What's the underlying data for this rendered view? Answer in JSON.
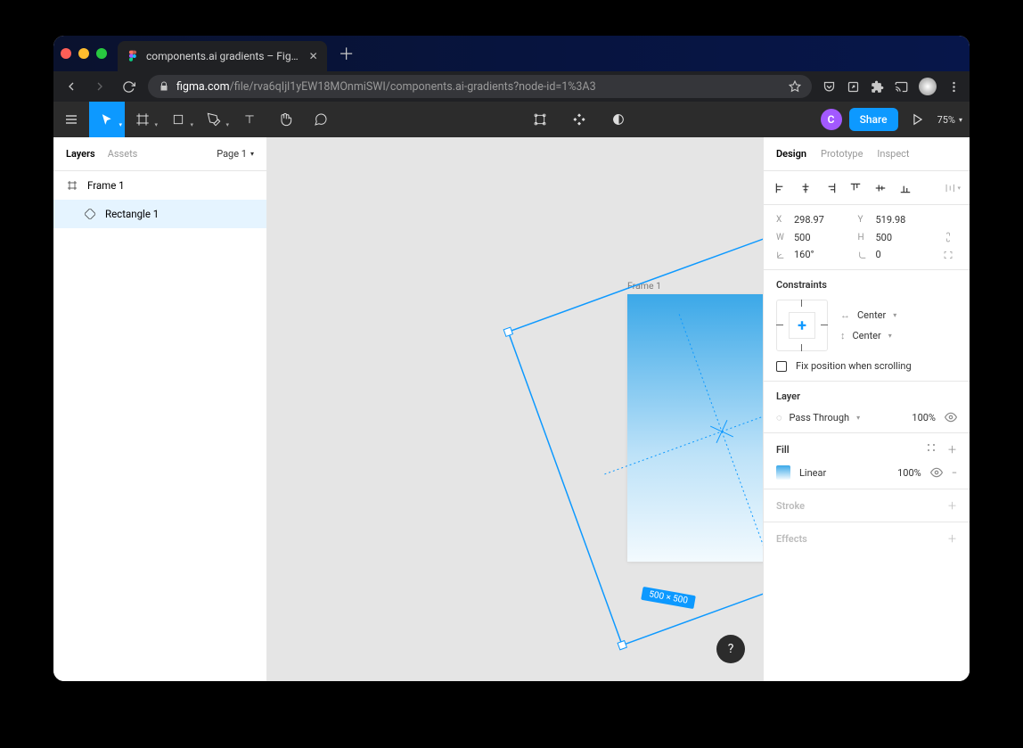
{
  "browser": {
    "tab_title": "components.ai gradients – Fig…",
    "url_domain": "figma.com",
    "url_path": "/file/rva6qIjl1yEW18MOnmiSWI/components.ai-gradients?node-id=1%3A3"
  },
  "toolbar": {
    "avatar_initial": "C",
    "share_label": "Share",
    "zoom": "75%"
  },
  "left_panel": {
    "tab_layers": "Layers",
    "tab_assets": "Assets",
    "page_label": "Page 1",
    "layer_frame": "Frame 1",
    "layer_rect": "Rectangle 1"
  },
  "canvas": {
    "frame_label": "Frame 1",
    "selection_size": "500 × 500"
  },
  "right_panel": {
    "tab_design": "Design",
    "tab_prototype": "Prototype",
    "tab_inspect": "Inspect",
    "pos": {
      "x_label": "X",
      "x": "298.97",
      "y_label": "Y",
      "y": "519.98",
      "w_label": "W",
      "w": "500",
      "h_label": "H",
      "h": "500",
      "angle": "160°",
      "radius": "0"
    },
    "constraints": {
      "title": "Constraints",
      "horizontal": "Center",
      "vertical": "Center",
      "fix_label": "Fix position when scrolling"
    },
    "layer": {
      "title": "Layer",
      "blend": "Pass Through",
      "opacity": "100%"
    },
    "fill": {
      "title": "Fill",
      "type": "Linear",
      "opacity": "100%"
    },
    "stroke": {
      "title": "Stroke"
    },
    "effects": {
      "title": "Effects"
    }
  }
}
